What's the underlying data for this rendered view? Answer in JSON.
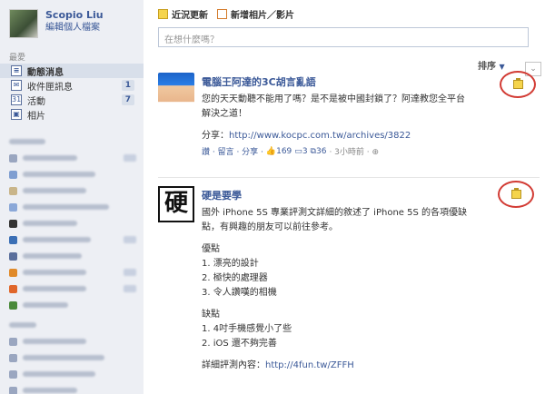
{
  "profile": {
    "name": "Scopio Liu",
    "edit_label": "編輯個人檔案"
  },
  "sidebar": {
    "section_label": "最愛",
    "items": [
      {
        "icon": "news-feed-icon",
        "glyph": "≡",
        "label": "動態消息",
        "count": ""
      },
      {
        "icon": "messages-icon",
        "glyph": "✉",
        "label": "收件匣訊息",
        "count": "1"
      },
      {
        "icon": "events-icon",
        "glyph": "31",
        "label": "活動",
        "count": "7"
      },
      {
        "icon": "photos-icon",
        "glyph": "▣",
        "label": "相片",
        "count": ""
      }
    ]
  },
  "composer": {
    "tabs": [
      {
        "icon": "status-update-icon",
        "label": "近況更新"
      },
      {
        "icon": "add-photo-video-icon",
        "label": "新增相片／影片"
      }
    ],
    "placeholder": "在想什麼嗎？"
  },
  "feed": {
    "sort_label": "排序",
    "sort_caret": "▼",
    "chevron": "⌄",
    "posts": [
      {
        "author": "電腦王阿達的3C胡言亂語",
        "lines": [
          "您的天天動聽不能用了嗎？是不是被中國封鎖了？阿達教您全平台",
          "解決之道！"
        ],
        "share_prefix": "分享：",
        "share_url": "http://www.kocpc.com.tw/archives/3822",
        "meta_links": "讚 · 留言 · 分享 ·",
        "likes": "169",
        "comments": "3",
        "shares": "36",
        "time": "· 3小時前 · ⊕"
      },
      {
        "author": "硬是要學",
        "avatar_char": "硬",
        "lines": [
          "國外 iPhone 5S 專業評測文詳細的敘述了 iPhone 5S 的各項優缺",
          "點，有興趣的朋友可以前往參考。"
        ],
        "pros_title": "優點",
        "pros": [
          "1. 漂亮的設計",
          "2. 極快的處理器",
          "3. 令人讚嘆的相機"
        ],
        "cons_title": "缺點",
        "cons": [
          "1. 4吋手機感覺小了些",
          "2. iOS 還不夠完善"
        ],
        "detail_label": "詳細評測內容：",
        "detail_url": "http://4fun.tw/ZFFH"
      }
    ]
  }
}
